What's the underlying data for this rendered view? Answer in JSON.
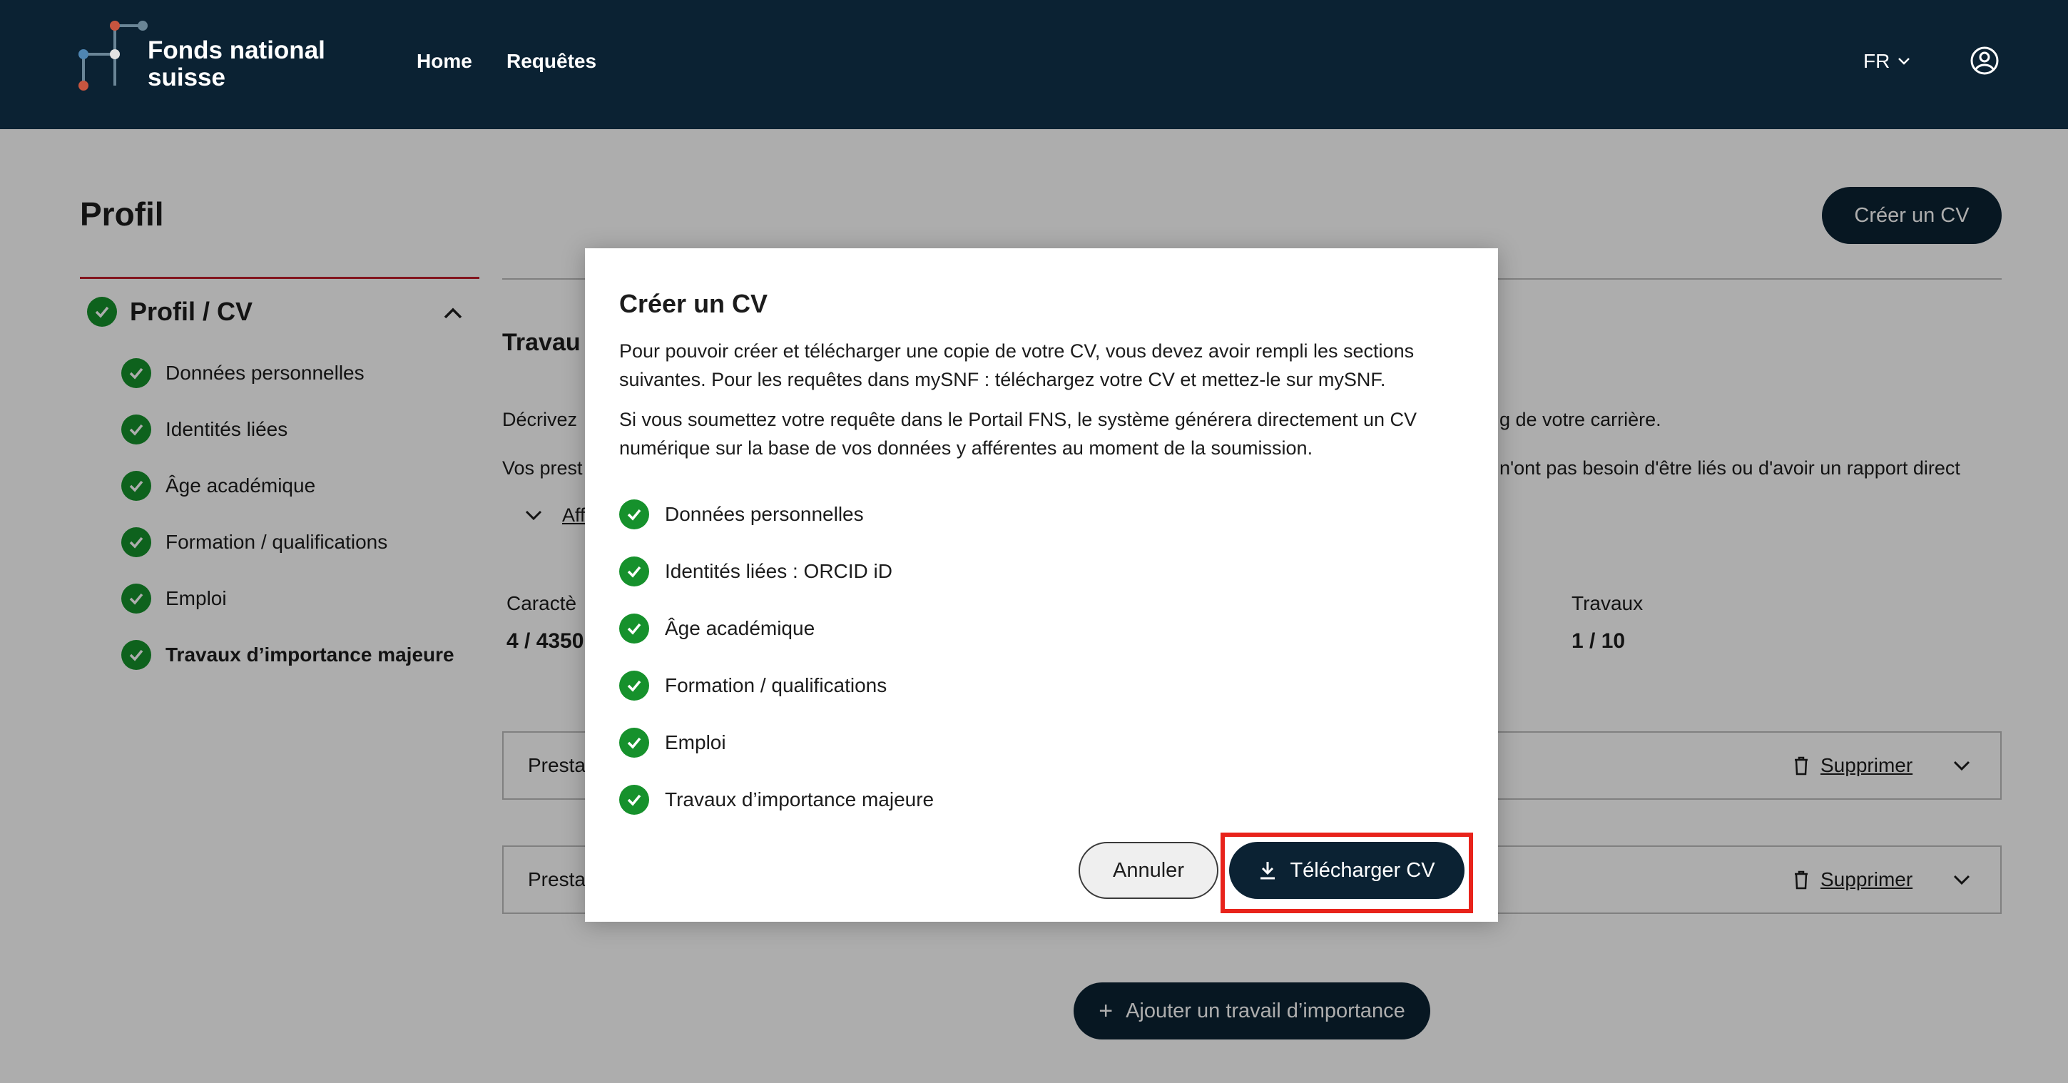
{
  "header": {
    "brand": "Fonds national suisse",
    "nav": [
      "Home",
      "Requêtes"
    ],
    "language": "FR",
    "icons": {
      "logo": "snf-logo",
      "user": "user-account-icon",
      "lang_chevron": "chevron-down-icon"
    },
    "bg_color": "#0b2233"
  },
  "page": {
    "title": "Profil",
    "create_cv_button": "Créer un CV"
  },
  "sidebar": {
    "heading": "Profil / CV",
    "items": [
      {
        "label": "Données personnelles",
        "done": true,
        "active": false
      },
      {
        "label": "Identités liées",
        "done": true,
        "active": false
      },
      {
        "label": "Âge académique",
        "done": true,
        "active": false
      },
      {
        "label": "Formation / qualifications",
        "done": true,
        "active": false
      },
      {
        "label": "Emploi",
        "done": true,
        "active": false
      },
      {
        "label": "Travaux d’importance majeure",
        "done": true,
        "active": true
      }
    ]
  },
  "main": {
    "section_title": "Travau",
    "desc_left": "Décrivez",
    "desc_right": "g de votre carrière.",
    "desc2_left": "Vos prest",
    "desc2_right": "n'ont pas besoin d'être liés ou d'avoir un rapport direct",
    "expander_text": "Aff",
    "stats": [
      {
        "label": "Caractè",
        "value": "4 / 4350"
      },
      {
        "label": "Travaux",
        "value": "1 / 10"
      }
    ],
    "rows": [
      {
        "label": "Presta",
        "delete": "Supprimer"
      },
      {
        "label": "Presta",
        "delete": "Supprimer"
      }
    ],
    "add_button": "Ajouter un travail d’importance"
  },
  "modal": {
    "title": "Créer un CV",
    "paragraph1": "Pour pouvoir créer et télécharger une copie de votre CV, vous devez avoir rempli les sections suivantes. Pour les requêtes dans mySNF : téléchargez votre CV et mettez-le sur mySNF.",
    "paragraph2": "Si vous soumettez votre requête dans le Portail FNS, le système générera directement un CV numérique sur la base de vos données y afférentes au moment de la soumission.",
    "checklist": [
      "Données personnelles",
      "Identités liées : ORCID iD",
      "Âge académique",
      "Formation / qualifications",
      "Emploi",
      "Travaux d’importance majeure"
    ],
    "cancel_button": "Annuler",
    "download_button": "Télécharger CV",
    "highlight_color": "#e8231b",
    "check_color": "#16912c"
  }
}
